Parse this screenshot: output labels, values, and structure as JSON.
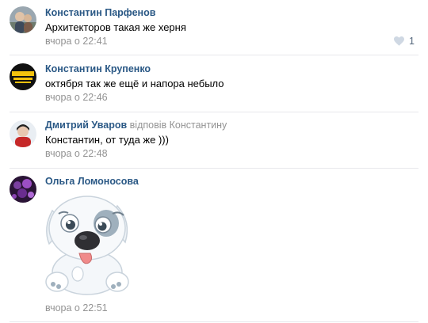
{
  "comments": [
    {
      "author": "Константин Парфенов",
      "reply_to": "",
      "text": "Архитекторов такая же херня",
      "time": "вчора о 22:41",
      "likes": "1",
      "avatar_icon": "user-photo-avatar"
    },
    {
      "author": "Константин Крупенко",
      "reply_to": "",
      "text": "октября так же ещё и напора небыло",
      "time": "вчора о 22:46",
      "likes": "",
      "avatar_icon": "logo-avatar"
    },
    {
      "author": "Дмитрий Уваров",
      "reply_to": "відповів Константину",
      "text": "Константин, от туда же )))",
      "time": "вчора о 22:48",
      "likes": "",
      "avatar_icon": "user-photo-avatar"
    },
    {
      "author": "Ольга Ломоносова",
      "reply_to": "",
      "text": "",
      "time": "вчора о 22:51",
      "likes": "",
      "avatar_icon": "flowers-avatar",
      "attachment": "dog-sticker"
    }
  ],
  "colors": {
    "author_link": "#2a5885",
    "meta_text": "#939393",
    "like_icon": "#cfd8e3",
    "divider": "#e7e8ec"
  }
}
